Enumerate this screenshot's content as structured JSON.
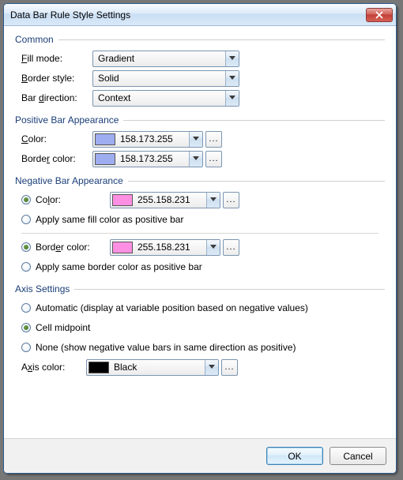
{
  "window": {
    "title": "Data Bar Rule Style Settings"
  },
  "icon": {
    "close": "close"
  },
  "groups": {
    "common": "Common",
    "positive": "Positive Bar Appearance",
    "negative": "Negative Bar Appearance",
    "axis": "Axis Settings"
  },
  "common": {
    "fill_mode_label_pre": "F",
    "fill_mode_label_post": "ill mode:",
    "fill_mode_value": "Gradient",
    "border_style_label_pre": "B",
    "border_style_label_post": "order style:",
    "border_style_value": "Solid",
    "bar_direction_label_pre": "Bar ",
    "bar_direction_label_mid": "d",
    "bar_direction_label_end": "irection:",
    "bar_direction_value": "Context"
  },
  "positive": {
    "color_label_pre": "C",
    "color_label_post": "olor:",
    "color_text": "158.173.255",
    "color_swatch": "#9EADF0",
    "border_label_pre": "Borde",
    "border_label_mid": "r",
    "border_label_end": " color:",
    "border_text": "158.173.255",
    "border_swatch": "#9EADF0"
  },
  "negative": {
    "color_radio_pre": "Co",
    "color_radio_mid": "l",
    "color_radio_end": "or:",
    "color_text": "255.158.231",
    "color_swatch": "#FF8FE2",
    "same_fill_pre": "A",
    "same_fill_mid": "p",
    "same_fill_end": "ply same fill color as positive bar",
    "border_radio_pre": "Bord",
    "border_radio_mid": "e",
    "border_radio_end": "r color:",
    "border_text": "255.158.231",
    "border_swatch": "#FF8FE2",
    "same_border_pre": "Apply ",
    "same_border_mid": "s",
    "same_border_end": "ame border color as positive bar"
  },
  "axis": {
    "auto_pre": "A",
    "auto_mid": "u",
    "auto_end": "tomatic (display at variable position based on negative values)",
    "mid_pre": "Cell ",
    "mid_mid": "m",
    "mid_end": "idpoint",
    "none_pre": "Non",
    "none_mid": "e",
    "none_end": " (show negative value bars in same direction as positive)",
    "axis_color_label_pre": "A",
    "axis_color_label_mid": "x",
    "axis_color_label_end": "is color:",
    "axis_color_text": "Black",
    "axis_color_swatch": "#000000"
  },
  "buttons": {
    "ok": "OK",
    "cancel": "Cancel",
    "ellipsis": "..."
  }
}
